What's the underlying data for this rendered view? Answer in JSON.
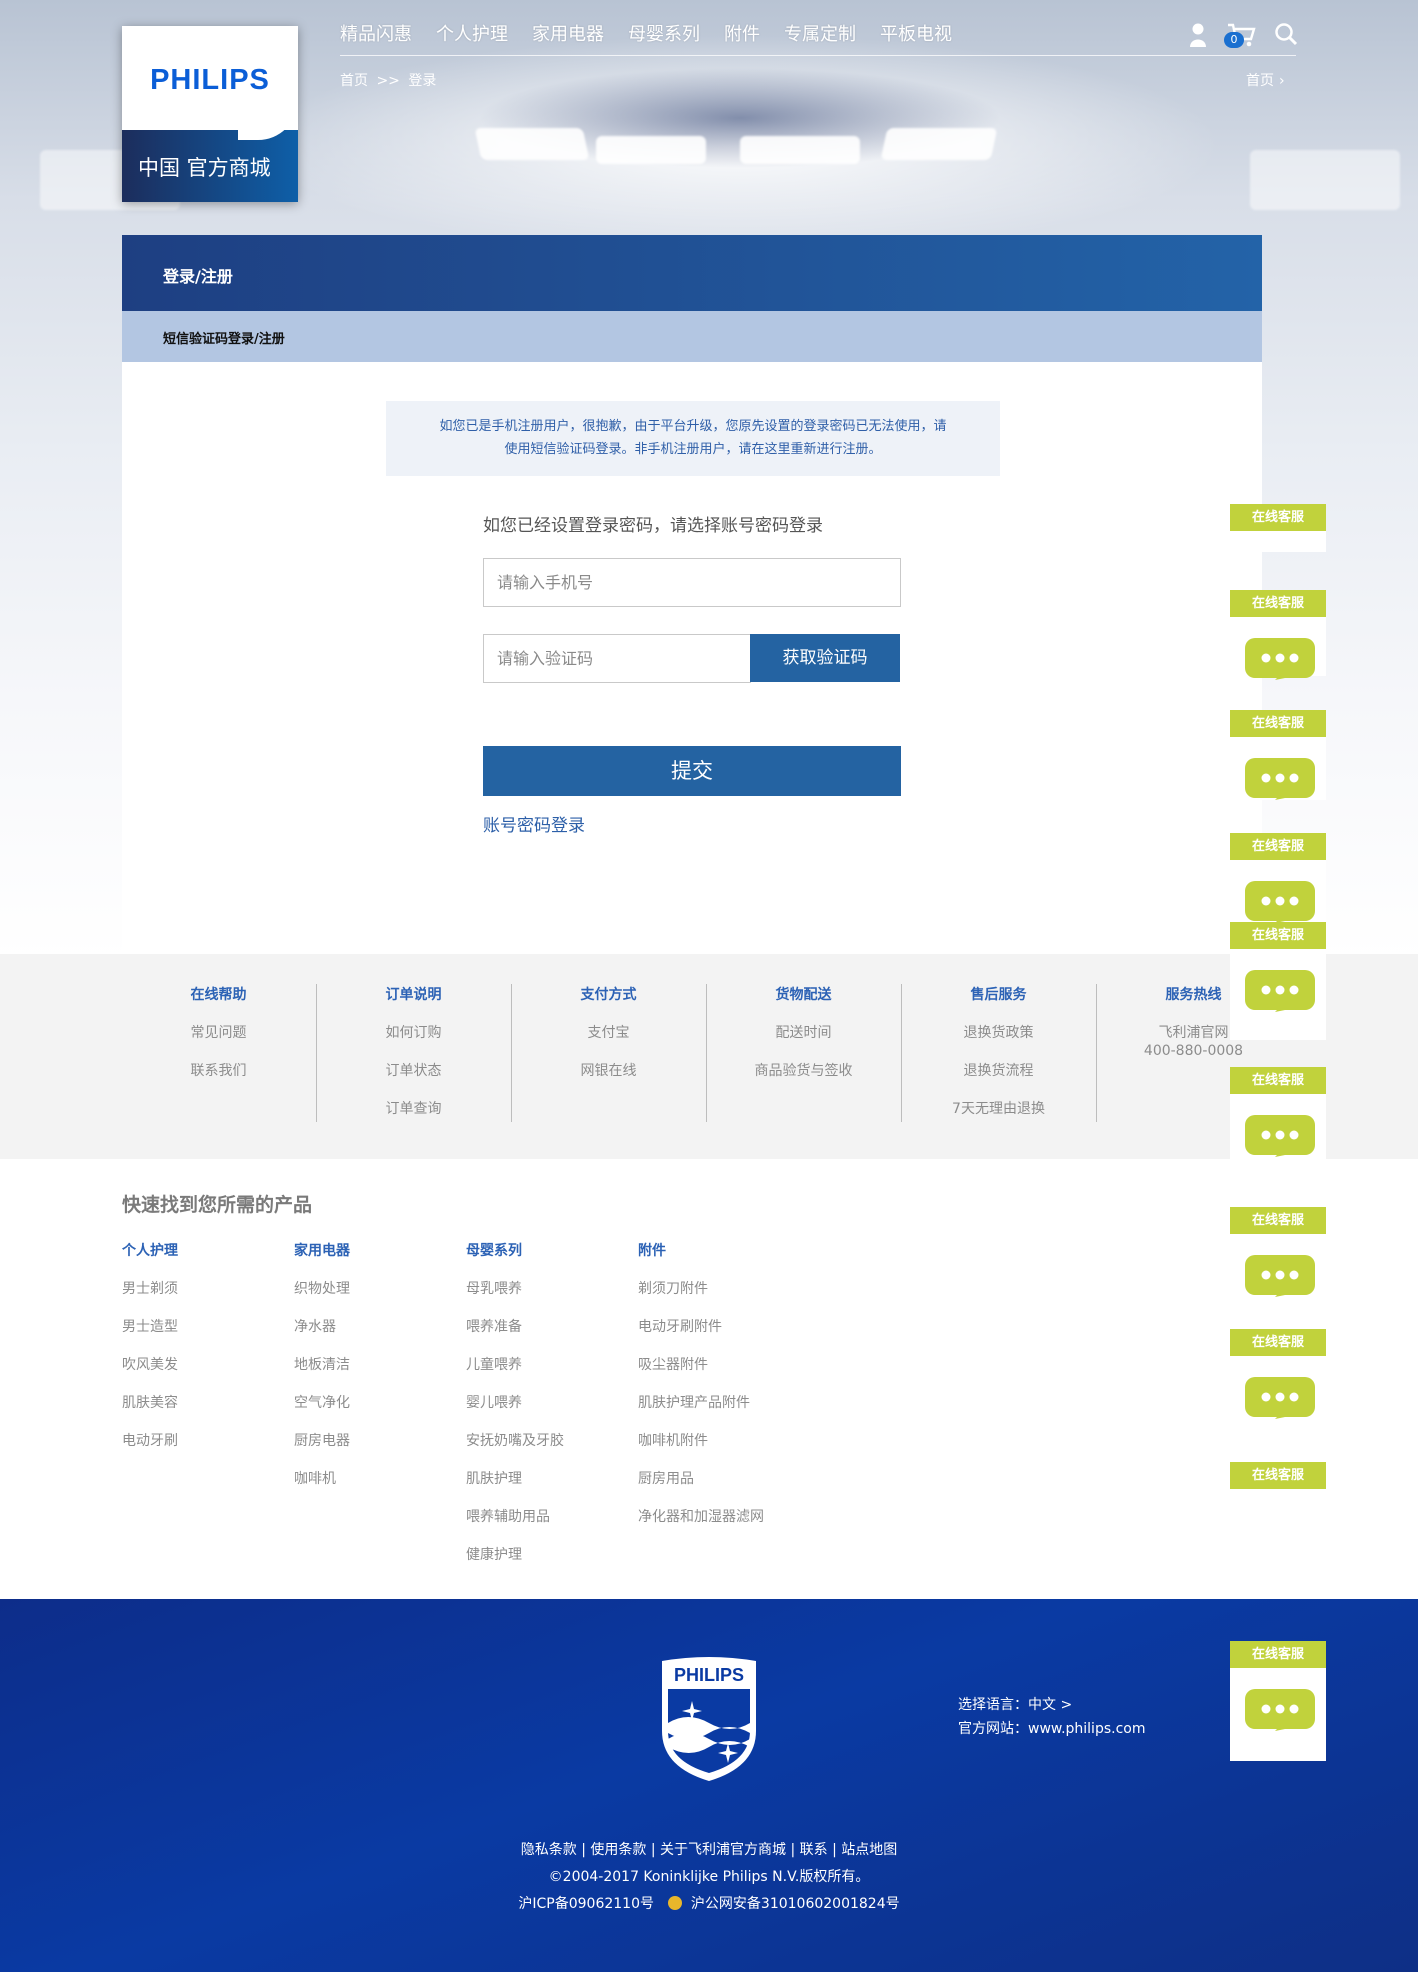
{
  "brand": {
    "logo_text": "PHILIPS",
    "store_name": "中国 官方商城"
  },
  "nav": {
    "items": [
      "精品闪惠",
      "个人护理",
      "家用电器",
      "母婴系列",
      "附件",
      "专属定制",
      "平板电视"
    ]
  },
  "header": {
    "cart_count": "0",
    "breadcrumb_home": "首页",
    "breadcrumb_sep": ">>",
    "breadcrumb_current": "登录",
    "home_link": "首页"
  },
  "login": {
    "title": "登录/注册",
    "subtitle": "短信验证码登录/注册",
    "notice_line1": "如您已是手机注册用户，很抱歉，由于平台升级，您原先设置的登录密码已无法使用，请",
    "notice_line2": "使用短信验证码登录。非手机注册用户，请在这里重新进行注册。",
    "tip": "如您已经设置登录密码，请选择账号密码登录",
    "phone_placeholder": "请输入手机号",
    "code_placeholder": "请输入验证码",
    "get_code": "获取验证码",
    "submit": "提交",
    "alt_login": "账号密码登录"
  },
  "service": [
    {
      "title": "在线帮助",
      "items": [
        "常见问题",
        "联系我们"
      ]
    },
    {
      "title": "订单说明",
      "items": [
        "如何订购",
        "订单状态",
        "订单查询"
      ]
    },
    {
      "title": "支付方式",
      "items": [
        "支付宝",
        "网银在线"
      ]
    },
    {
      "title": "货物配送",
      "items": [
        "配送时间",
        "商品验货与签收"
      ]
    },
    {
      "title": "售后服务",
      "items": [
        "退换货政策",
        "退换货流程",
        "7天无理由退换"
      ]
    },
    {
      "title": "服务热线",
      "items": [
        "飞利浦官网",
        "400-880-0008"
      ]
    }
  ],
  "quick": {
    "title": "快速找到您所需的产品",
    "columns": [
      {
        "title": "个人护理",
        "items": [
          "男士剃须",
          "男士造型",
          "吹风美发",
          "肌肤美容",
          "电动牙刷"
        ]
      },
      {
        "title": "家用电器",
        "items": [
          "织物处理",
          "净水器",
          "地板清洁",
          "空气净化",
          "厨房电器",
          "咖啡机"
        ]
      },
      {
        "title": "母婴系列",
        "items": [
          "母乳喂养",
          "喂养准备",
          "儿童喂养",
          "婴儿喂养",
          "安抚奶嘴及牙胶",
          "肌肤护理",
          "喂养辅助用品",
          "健康护理"
        ]
      },
      {
        "title": "附件",
        "items": [
          "剃须刀附件",
          "电动牙刷附件",
          "吸尘器附件",
          "肌肤护理产品附件",
          "咖啡机附件",
          "厨房用品",
          "净化器和加湿器滤网"
        ]
      }
    ]
  },
  "float_service": {
    "label": "在线客服"
  },
  "footer": {
    "shield_text": "PHILIPS",
    "language": "选择语言：中文 >",
    "website": "官方网站：www.philips.com",
    "links": "隐私条款 | 使用条款 | 关于飞利浦官方商城 | 联系 | 站点地图",
    "copyright": "©2004-2017 Koninklijke Philips N.V.版权所有。",
    "icp": "沪ICP备09062110号",
    "police": "沪公网安备31010602001824号"
  },
  "colors": {
    "accent": "#2463a2",
    "header_band": "#1e3f82",
    "sub_band": "#b3c6e2",
    "service_green": "#c1d23c",
    "footer_blue": "#0a3aa3"
  }
}
